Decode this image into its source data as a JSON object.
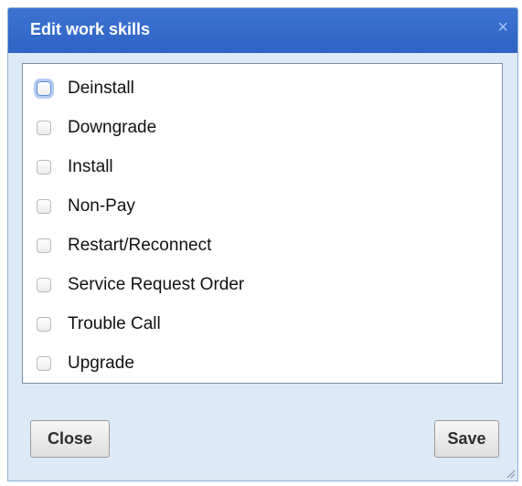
{
  "dialog": {
    "title": "Edit work skills",
    "close_icon_glyph": "×"
  },
  "skills": [
    {
      "label": "Deinstall",
      "checked": false,
      "focused": true
    },
    {
      "label": "Downgrade",
      "checked": false
    },
    {
      "label": "Install",
      "checked": false
    },
    {
      "label": "Non-Pay",
      "checked": false
    },
    {
      "label": "Restart/Reconnect",
      "checked": false
    },
    {
      "label": "Service Request Order",
      "checked": false
    },
    {
      "label": "Trouble Call",
      "checked": false
    },
    {
      "label": "Upgrade",
      "checked": false
    }
  ],
  "buttons": {
    "close_label": "Close",
    "save_label": "Save"
  },
  "colors": {
    "titlebar": "#3368ca",
    "dialog_bg": "#dce9f7",
    "panel_border": "#7d8ea9"
  }
}
